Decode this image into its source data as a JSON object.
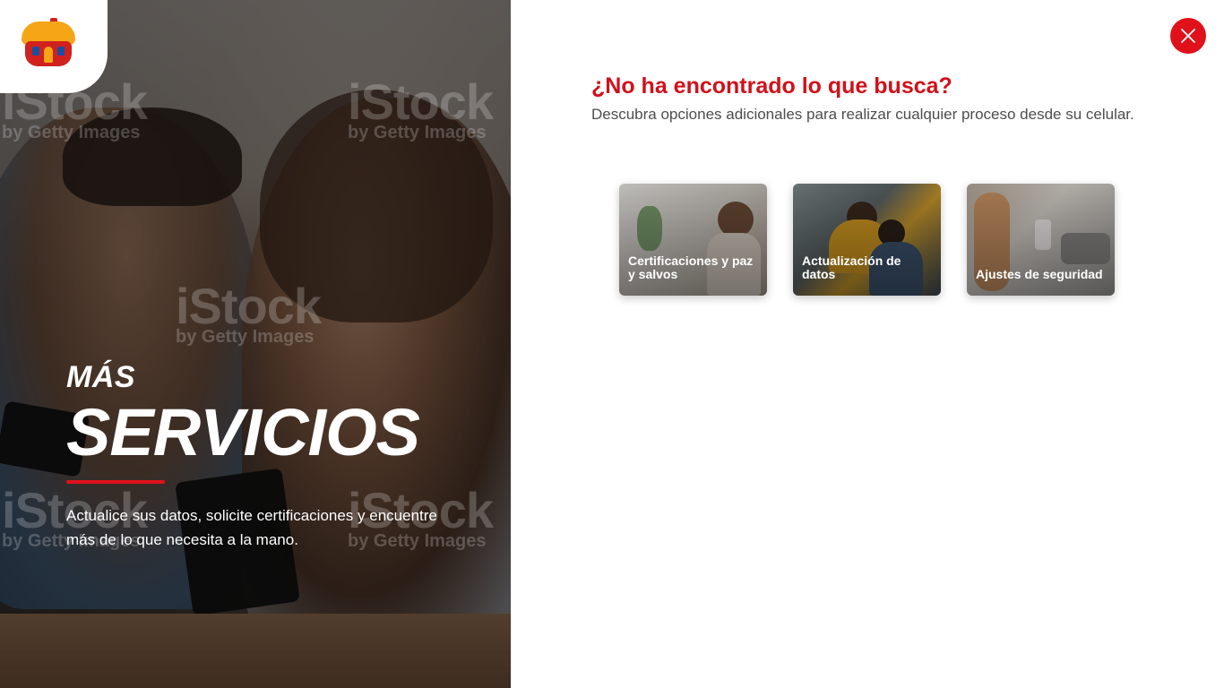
{
  "brand": {
    "logo_name": "house-logo",
    "colors": {
      "red": "#e1111b",
      "yellow": "#f5a516",
      "blue": "#1b4ea0"
    }
  },
  "hero": {
    "kicker": "MÁS",
    "title": "SERVICIOS",
    "description": "Actualice sus datos, solicite certificaciones y encuentre más de lo que necesita a la mano.",
    "watermark_main": "iStock",
    "watermark_sub": "by Getty Images"
  },
  "close": {
    "icon": "close-icon",
    "label": "Cerrar"
  },
  "main": {
    "heading": "¿No ha encontrado lo que busca?",
    "subheading": "Descubra opciones adicionales para realizar cualquier proceso desde su celular."
  },
  "cards": [
    {
      "label": "Certificaciones y paz y salvos"
    },
    {
      "label": "Actualización de datos"
    },
    {
      "label": "Ajustes de seguridad"
    }
  ]
}
